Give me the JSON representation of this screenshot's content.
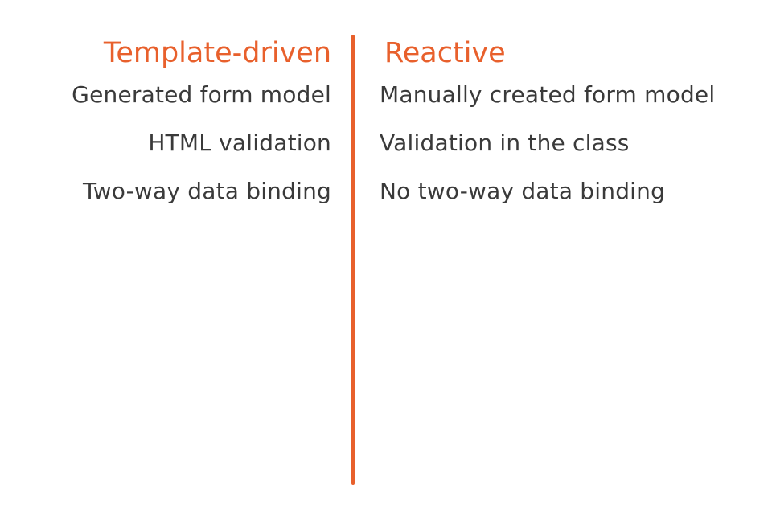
{
  "colors": {
    "accent": "#e8602c",
    "text": "#3a3a3a",
    "background": "#ffffff"
  },
  "left": {
    "title": "Template-driven",
    "items": [
      "Generated form model",
      "HTML validation",
      "Two-way data binding"
    ]
  },
  "right": {
    "title": "Reactive",
    "items": [
      "Manually created form model",
      "Validation in the class",
      "No two-way data binding"
    ]
  }
}
